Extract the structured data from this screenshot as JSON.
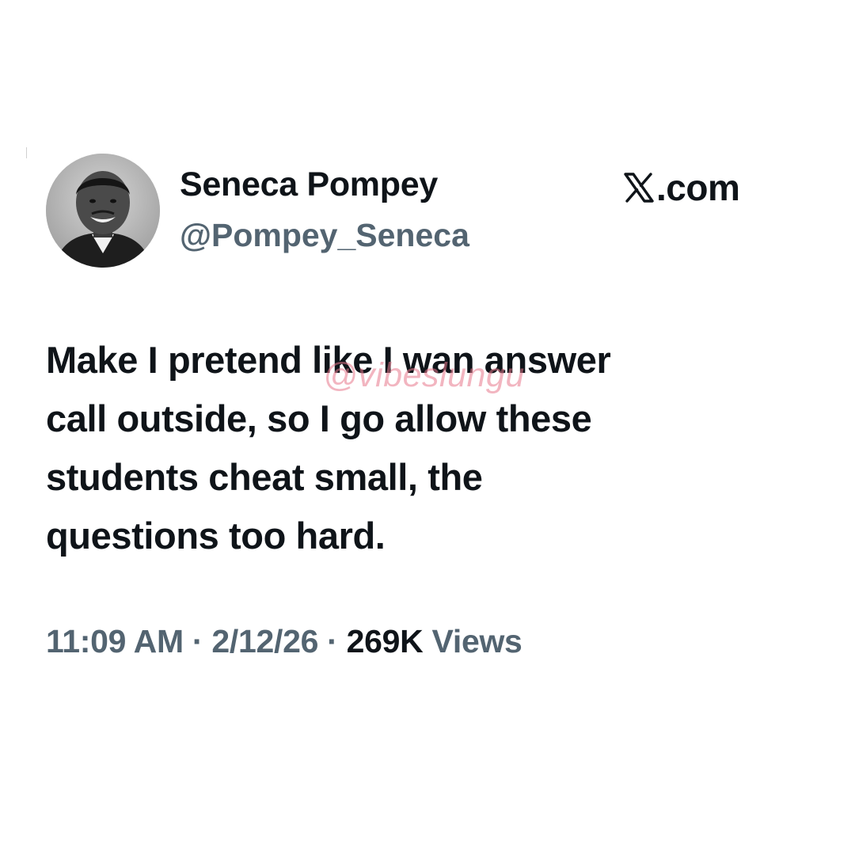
{
  "author": {
    "display_name": "Seneca Pompey",
    "handle": "@Pompey_Seneca",
    "avatar_icon": "profile-photo"
  },
  "platform": {
    "logo_icon": "x-logo-icon",
    "domain": ".com"
  },
  "tweet": {
    "text": "Make I pretend like I wan answer\ncall outside, so I go allow these\nstudents cheat small, the\nquestions too hard."
  },
  "watermark": {
    "text": "@vibeslungu"
  },
  "meta": {
    "time": "11:09 AM",
    "separator_1": " · ",
    "date": "2/12/26",
    "separator_2": " · ",
    "views_count": "269K",
    "views_label": " Views"
  },
  "colors": {
    "text_primary": "#0f1419",
    "text_secondary": "#536471",
    "watermark": "#e8788c"
  }
}
